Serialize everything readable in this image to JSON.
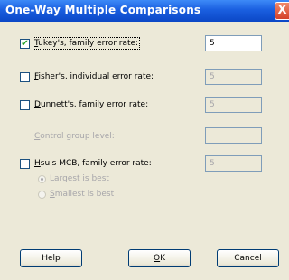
{
  "window": {
    "title": "One-Way Multiple Comparisons",
    "close_glyph": "X"
  },
  "options": {
    "tukey": {
      "checked": true,
      "label_prefix": "",
      "label_mnemonic": "T",
      "label_rest": "ukey's, family error rate:",
      "value": "5"
    },
    "fisher": {
      "checked": false,
      "label_mnemonic": "F",
      "label_rest": "isher's, individual error rate:",
      "value": "5"
    },
    "dunnett": {
      "checked": false,
      "label_mnemonic": "D",
      "label_rest": "unnett's, family error rate:",
      "value": "5"
    },
    "control": {
      "label_mnemonic": "C",
      "label_rest": "ontrol group level:",
      "value": ""
    },
    "hsu": {
      "checked": false,
      "label_mnemonic": "H",
      "label_rest": "su's MCB, family error rate:",
      "value": "5"
    },
    "largest": {
      "selected": true,
      "label_mnemonic": "L",
      "label_rest": "argest is best"
    },
    "smallest": {
      "selected": false,
      "label_mnemonic": "S",
      "label_rest": "mallest is best"
    }
  },
  "buttons": {
    "help": "Help",
    "ok_mnemonic": "O",
    "ok_rest": "K",
    "cancel": "Cancel"
  },
  "checkmark_glyph": "✔"
}
